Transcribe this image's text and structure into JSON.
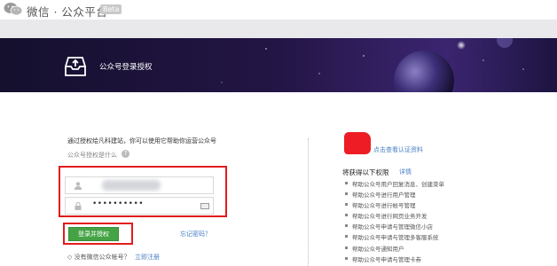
{
  "topbar": {
    "brand": "微信 · 公众平台",
    "badge": "Beta",
    "logo_icon": "wechat-logo-icon"
  },
  "header": {
    "title": "公众号登录授权",
    "icon": "inbox-upload-icon",
    "colors": {
      "banner_dark": "#1b1036",
      "banner_mid": "#3a1f6a"
    }
  },
  "login": {
    "intro": "通过授权给凡科建站，你可以使用它帮助你运营公众号",
    "what_is_auth": "公众号授权是什么",
    "help_icon": "question-circle-icon",
    "username_icon": "user-icon",
    "password_icon": "lock-icon",
    "password_value": "••••••••••",
    "keyboard_icon": "keyboard-icon",
    "submit_label": "登录并授权",
    "forgot_label": "忘记密码？",
    "no_account_text": "◇ 没有微信公众帐号？",
    "register_label": "立即注册",
    "highlight_color": "#e31b1b",
    "button_color": "#45a346"
  },
  "side": {
    "verify_link": "点击查看认证资料",
    "perm_title": "将获得以下权限",
    "perm_detail": "详情",
    "permissions": [
      "帮助公众号用户回复消息、创建菜单",
      "帮助公众号进行用户管理",
      "帮助公众号进行帐号管理",
      "帮助公众号进行网页业务开发",
      "帮助公众号申请与管理微信小店",
      "帮助公众号申请与管理多客服系统",
      "帮助公众号通知用户",
      "帮助公众号申请与管理卡券"
    ]
  }
}
